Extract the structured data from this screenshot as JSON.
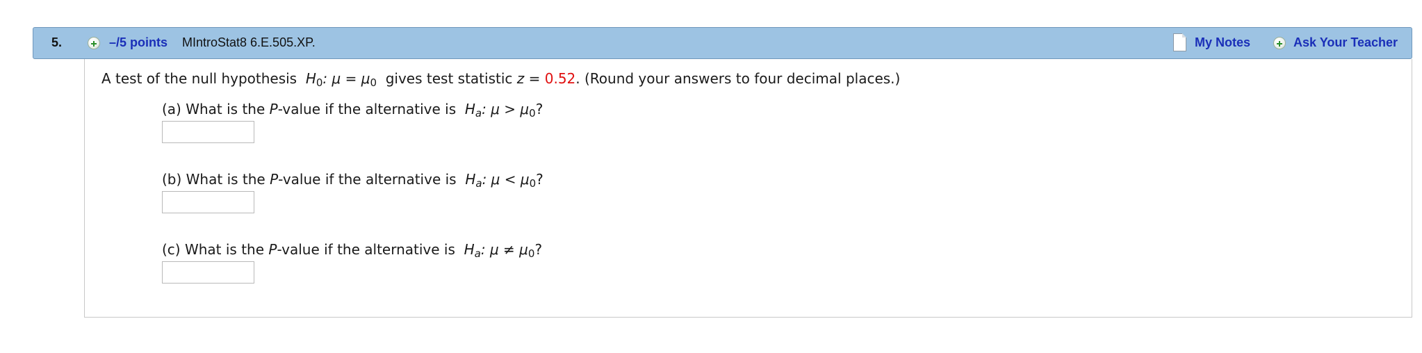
{
  "header": {
    "question_number": "5.",
    "points": "–/5 points",
    "source": "MIntroStat8 6.E.505.XP.",
    "my_notes": "My Notes",
    "ask_teacher": "Ask Your Teacher"
  },
  "intro": {
    "part1": "A test of the null hypothesis",
    "H": "H",
    "sub0": "0",
    "null_relation": ": μ = μ",
    "part2": "gives test statistic",
    "z": "z",
    "eq": "=",
    "z_value": "0.52",
    "part3": ". (Round your answers to four decimal places.)"
  },
  "parts": [
    {
      "label": "(a) What is the",
      "P": "P",
      "mid": "-value if the alternative is",
      "H": "H",
      "suba": "a",
      "relation": ": μ > μ",
      "sub0": "0",
      "end": "?",
      "answer": ""
    },
    {
      "label": "(b) What is the",
      "P": "P",
      "mid": "-value if the alternative is",
      "H": "H",
      "suba": "a",
      "relation": ": μ < μ",
      "sub0": "0",
      "end": "?",
      "answer": ""
    },
    {
      "label": "(c) What is the",
      "P": "P",
      "mid": "-value if the alternative is",
      "H": "H",
      "suba": "a",
      "relation": ": μ ≠ μ",
      "sub0": "0",
      "end": "?",
      "answer": ""
    }
  ],
  "colors": {
    "header_bg": "#9dc3e3",
    "link": "#1a2fb8",
    "statistic": "#e01010"
  }
}
